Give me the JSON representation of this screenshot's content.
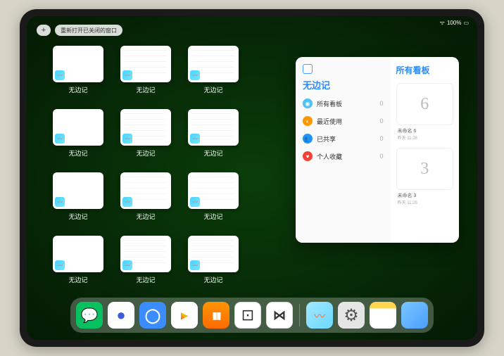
{
  "status": {
    "battery": "100%",
    "signal": "•ıl"
  },
  "controls": {
    "plus": "+",
    "reopen": "重新打开已关闭的窗口"
  },
  "app_label": "无边记",
  "windows": [
    {
      "detailed": false
    },
    {
      "detailed": true
    },
    {
      "detailed": true
    },
    {
      "detailed": false
    },
    {
      "detailed": true
    },
    {
      "detailed": true
    },
    {
      "detailed": false
    },
    {
      "detailed": true
    },
    {
      "detailed": true
    },
    {
      "detailed": false
    },
    {
      "detailed": true
    },
    {
      "detailed": true
    }
  ],
  "popup": {
    "title": "无边记",
    "right_title": "所有看板",
    "items": [
      {
        "label": "所有看板",
        "count": "0",
        "color": "#4fc3f7"
      },
      {
        "label": "最近使用",
        "count": "0",
        "color": "#ff9800"
      },
      {
        "label": "已共享",
        "count": "0",
        "color": "#2196f3"
      },
      {
        "label": "个人收藏",
        "count": "0",
        "color": "#f44336"
      }
    ],
    "boards": [
      {
        "sketch": "6",
        "label": "未命名 6",
        "time": "昨天 11:28"
      },
      {
        "sketch": "3",
        "label": "未命名 3",
        "time": "昨天 11:25"
      }
    ]
  },
  "dock": {
    "apps": [
      "wechat",
      "browser1",
      "browser2",
      "play",
      "books",
      "dice",
      "connect"
    ],
    "recent": [
      "freeform",
      "settings",
      "notes",
      "folder"
    ]
  }
}
